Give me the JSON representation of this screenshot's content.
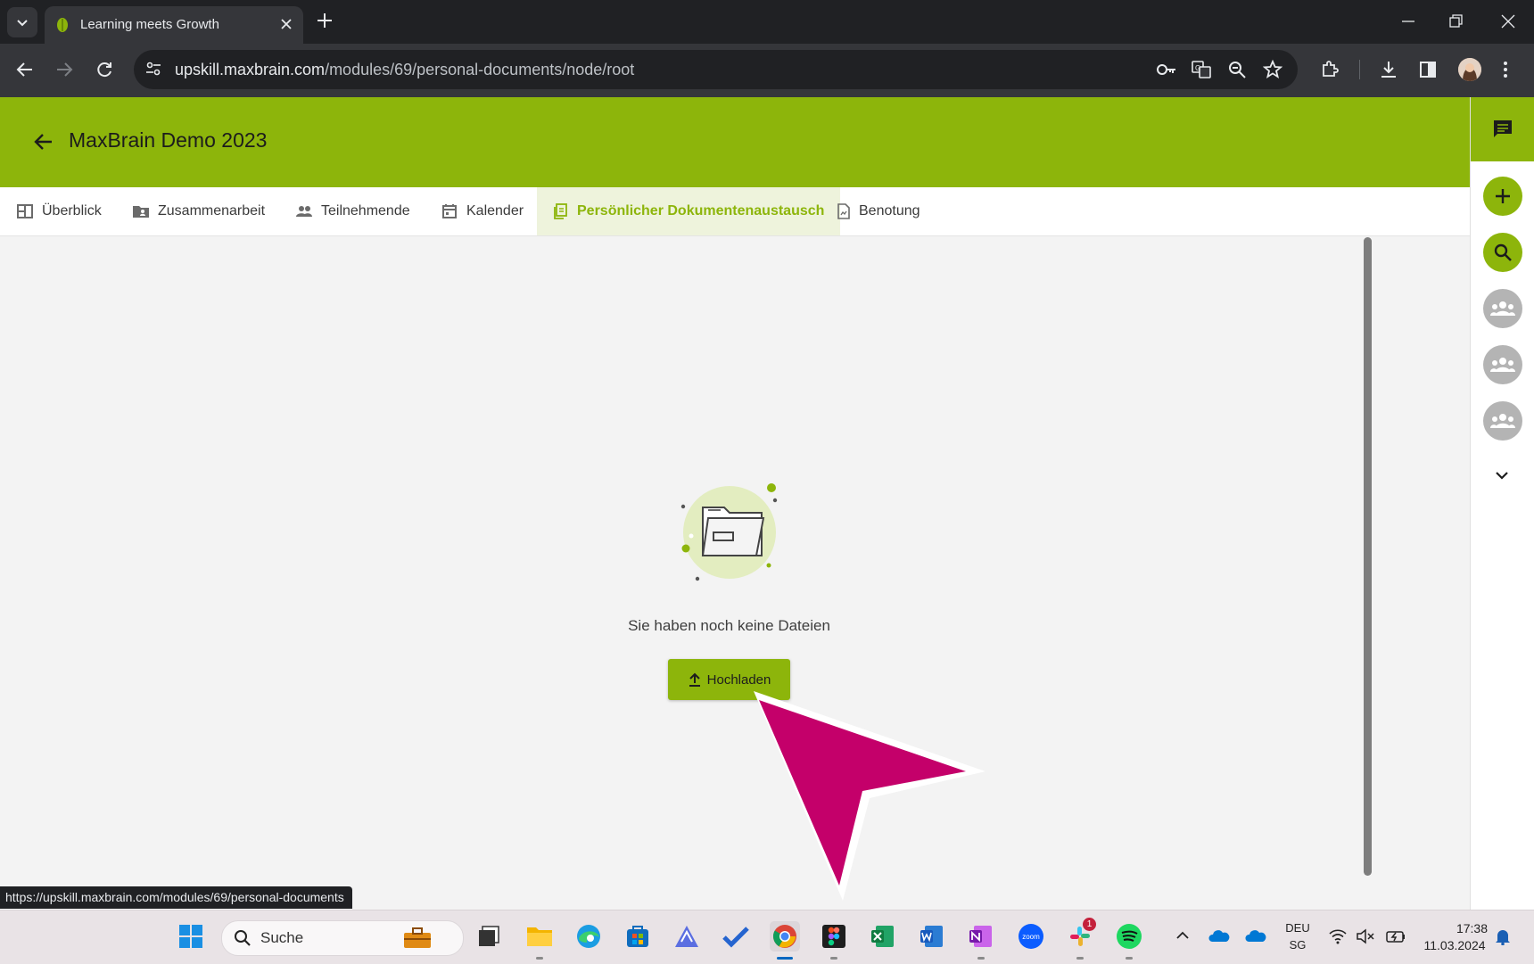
{
  "browser": {
    "tab_title": "Learning meets Growth",
    "url_host": "upskill.maxbrain.com",
    "url_path": "/modules/69/personal-documents/node/root",
    "status_url": "https://upskill.maxbrain.com/modules/69/personal-documents"
  },
  "app": {
    "title": "MaxBrain Demo 2023",
    "accent_color": "#8db50b"
  },
  "nav_tabs": [
    {
      "label": "Überblick",
      "icon": "dashboard-icon"
    },
    {
      "label": "Zusammenarbeit",
      "icon": "folder-shared-icon"
    },
    {
      "label": "Teilnehmende",
      "icon": "people-icon"
    },
    {
      "label": "Kalender",
      "icon": "calendar-icon"
    },
    {
      "label": "Persönlicher Dokumentenaustausch",
      "icon": "documents-icon",
      "active": true
    },
    {
      "label": "Benotung",
      "icon": "grade-document-icon"
    }
  ],
  "empty_state": {
    "message": "Sie haben noch keine Dateien",
    "upload_label": "Hochladen"
  },
  "taskbar": {
    "search_label": "Suche",
    "language_top": "DEU",
    "language_bottom": "SG",
    "time": "17:38",
    "date": "11.03.2024",
    "slack_badge": "1"
  }
}
